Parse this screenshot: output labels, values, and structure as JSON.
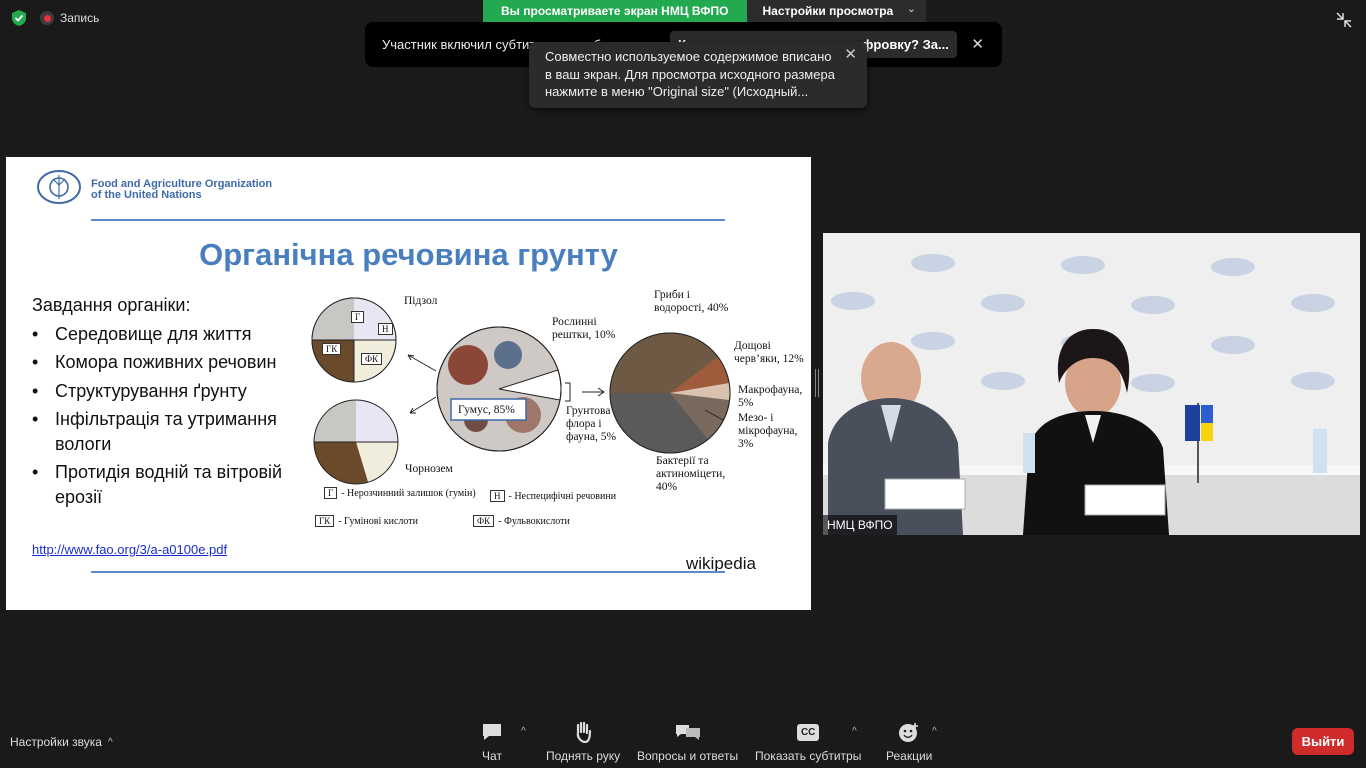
{
  "top": {
    "record_label": "Запись",
    "share_banner": "Вы просматриваете экран НМЦ ВФПО",
    "view_settings": "Настройки просмотра"
  },
  "notification": {
    "text": "Участник включил субтитры по требованию.",
    "question": "Кто может видеть эту расшифровку? За..."
  },
  "tooltip": {
    "line1": "Совместно используемое содержимое вписано",
    "line2": "в ваш экран. Для просмотра исходного размера",
    "line3": "нажмите в меню \"Original size\" (Исходный..."
  },
  "slide": {
    "org_line1": "Food and Agriculture Organization",
    "org_line2": "of the United Nations",
    "title": "Органічна речовина грунту",
    "tasks_heading": "Завдання органіки:",
    "tasks": [
      "Середовище для життя",
      "Комора поживних речовин",
      "Структурування ґрунту",
      "Інфільтрація та утримання вологи",
      "Протидія водній та вітровій ерозії"
    ],
    "link": "http://www.fao.org/3/a-a0100e.pdf",
    "source": "wikipedia",
    "diagram": {
      "podzol": "Підзол",
      "chernozem": "Чорнозем",
      "plant_residue": "Рослинні рештки, 10%",
      "humus": "Гумус, 85%",
      "soil_flora": "Грунтова флора і фауна, 5%",
      "fungi": "Гриби і водорості, 40%",
      "earthworms": "Дощові черв’яки, 12%",
      "macrofauna": "Макрофауна, 5%",
      "meso": "Мезо- і мікрофауна, 3%",
      "bacteria": "Бактерії та актиноміцети, 40%",
      "legend": [
        {
          "code": "Г",
          "text": "- Нерозчинний залишок (гумін)"
        },
        {
          "code": "Н",
          "text": "- Неспецифічні речовини"
        },
        {
          "code": "ГК",
          "text": "- Гумінові кислоти"
        },
        {
          "code": "ФК",
          "text": "- Фульвокислоти"
        }
      ],
      "pie_codes": [
        "Г",
        "Н",
        "ГК",
        "ФК"
      ]
    }
  },
  "video": {
    "participant_name": "НМЦ ВФПО"
  },
  "toolbar": {
    "audio_settings": "Настройки звука",
    "chat": "Чат",
    "raise_hand": "Поднять руку",
    "qa": "Вопросы и ответы",
    "captions": "Показать субтитры",
    "captions_icon_text": "CC",
    "reactions": "Реакции",
    "leave": "Выйти"
  },
  "colors": {
    "share_green": "#23a94f",
    "leave_red": "#d02b2b",
    "title_blue": "#4a7fbf"
  }
}
